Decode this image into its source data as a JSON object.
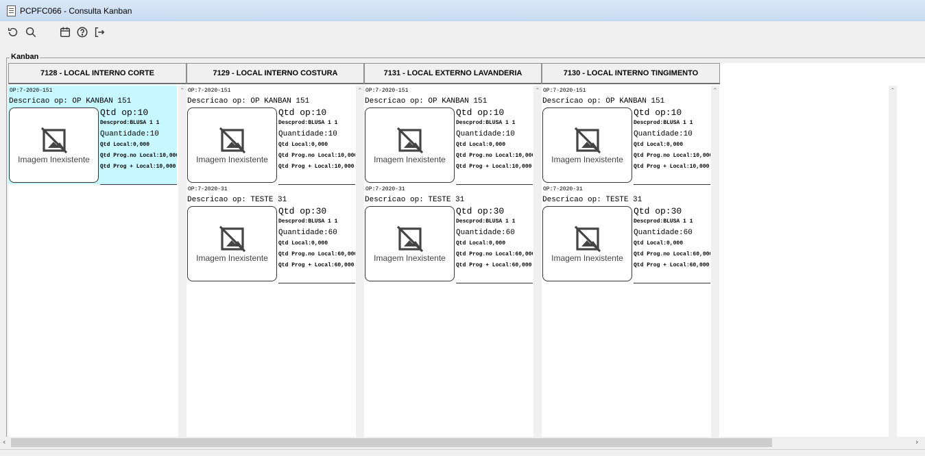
{
  "window": {
    "title": "PCPFC066 - Consulta Kanban"
  },
  "toolbar": {
    "buttons": [
      {
        "name": "refresh-icon"
      },
      {
        "name": "search-icon"
      },
      {
        "name": "calendar-icon"
      },
      {
        "name": "help-icon"
      },
      {
        "name": "exit-icon"
      }
    ]
  },
  "kanban": {
    "label": "Kanban",
    "columns": [
      {
        "title": "7128 - LOCAL INTERNO CORTE",
        "cards": [
          {
            "op": "OP:7-2020-151",
            "desc": "Descricao op: OP KANBAN 151",
            "qtd_op": "Qtd op:10",
            "descprod": "Descprod:BLUSA 1 1",
            "quantidade": "Quantidade:10",
            "qtd_local": "Qtd Local:0,000",
            "qtd_prog_no_local": "Qtd Prog.no Local:10,000",
            "qtd_prog_local": "Qtd Prog + Local:10,000",
            "image_text": "Imagem Inexistente"
          }
        ]
      },
      {
        "title": "7129 - LOCAL INTERNO COSTURA",
        "cards": [
          {
            "op": "OP:7-2020-151",
            "desc": "Descricao op: OP KANBAN 151",
            "qtd_op": "Qtd op:10",
            "descprod": "Descprod:BLUSA 1 1",
            "quantidade": "Quantidade:10",
            "qtd_local": "Qtd Local:0,000",
            "qtd_prog_no_local": "Qtd Prog.no Local:10,000",
            "qtd_prog_local": "Qtd Prog + Local:10,000",
            "image_text": "Imagem Inexistente"
          },
          {
            "op": "OP:7-2020-31",
            "desc": "Descricao op: TESTE 31",
            "qtd_op": "Qtd op:30",
            "descprod": "Descprod:BLUSA 1 1",
            "quantidade": "Quantidade:60",
            "qtd_local": "Qtd Local:0,000",
            "qtd_prog_no_local": "Qtd Prog.no Local:60,000",
            "qtd_prog_local": "Qtd Prog + Local:60,000",
            "image_text": "Imagem Inexistente"
          }
        ]
      },
      {
        "title": "7131 - LOCAL EXTERNO LAVANDERIA",
        "cards": [
          {
            "op": "OP:7-2020-151",
            "desc": "Descricao op: OP KANBAN 151",
            "qtd_op": "Qtd op:10",
            "descprod": "Descprod:BLUSA 1 1",
            "quantidade": "Quantidade:10",
            "qtd_local": "Qtd Local:0,000",
            "qtd_prog_no_local": "Qtd Prog.no Local:10,000",
            "qtd_prog_local": "Qtd Prog + Local:10,000",
            "image_text": "Imagem Inexistente"
          },
          {
            "op": "OP:7-2020-31",
            "desc": "Descricao op: TESTE 31",
            "qtd_op": "Qtd op:30",
            "descprod": "Descprod:BLUSA 1 1",
            "quantidade": "Quantidade:60",
            "qtd_local": "Qtd Local:0,000",
            "qtd_prog_no_local": "Qtd Prog.no Local:60,000",
            "qtd_prog_local": "Qtd Prog + Local:60,000",
            "image_text": "Imagem Inexistente"
          }
        ]
      },
      {
        "title": "7130 - LOCAL INTERNO TINGIMENTO",
        "cards": [
          {
            "op": "OP:7-2020-151",
            "desc": "Descricao op: OP KANBAN 151",
            "qtd_op": "Qtd op:10",
            "descprod": "Descprod:BLUSA 1 1",
            "quantidade": "Quantidade:10",
            "qtd_local": "Qtd Local:0,000",
            "qtd_prog_no_local": "Qtd Prog.no Local:10,000",
            "qtd_prog_local": "Qtd Prog + Local:10,000",
            "image_text": "Imagem Inexistente"
          },
          {
            "op": "OP:7-2020-31",
            "desc": "Descricao op: TESTE 31",
            "qtd_op": "Qtd op:30",
            "descprod": "Descprod:BLUSA 1 1",
            "quantidade": "Quantidade:60",
            "qtd_local": "Qtd Local:0,000",
            "qtd_prog_no_local": "Qtd Prog.no Local:60,000",
            "qtd_prog_local": "Qtd Prog + Local:60,000",
            "image_text": "Imagem Inexistente"
          }
        ]
      }
    ]
  },
  "colors": {
    "selected_card": "#c8f8ff",
    "title_bar": "#c7daf1"
  }
}
